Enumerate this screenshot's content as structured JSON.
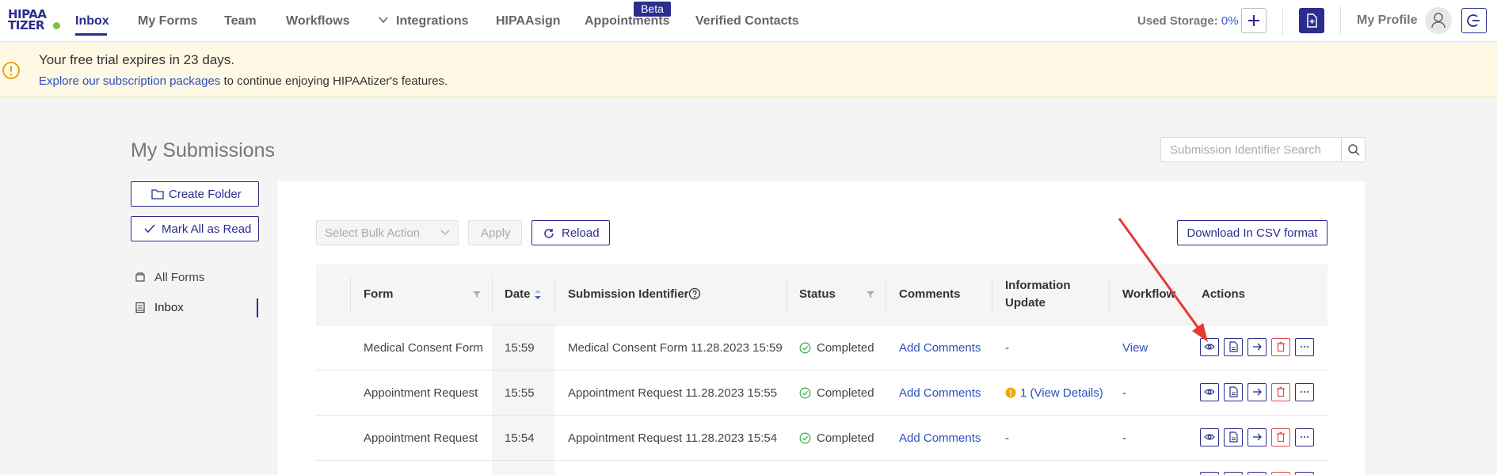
{
  "nav": {
    "logo_line1": "HIPAA",
    "logo_line2": "TIZER",
    "items": [
      "Inbox",
      "My Forms",
      "Team",
      "Workflows",
      "Integrations",
      "HIPAAsign",
      "Appointments",
      "Verified Contacts"
    ],
    "beta_badge": "Beta",
    "storage_label": "Used Storage:",
    "storage_value": "0%",
    "profile_label": "My Profile",
    "brand_color": "#2b2d8e"
  },
  "banner": {
    "title": "Your free trial expires in 23 days.",
    "link_text": "Explore our subscription packages",
    "suffix": " to continue enjoying HIPAAtizer's features."
  },
  "page": {
    "title": "My Submissions",
    "search_placeholder": "Submission Identifier Search"
  },
  "sidebar": {
    "create_folder": "Create Folder",
    "mark_all_read": "Mark All as Read",
    "items": [
      {
        "label": "All Forms",
        "icon": "box-icon"
      },
      {
        "label": "Inbox",
        "icon": "inbox-icon"
      }
    ]
  },
  "toolbar": {
    "bulk_placeholder": "Select Bulk Action",
    "apply": "Apply",
    "reload": "Reload",
    "csv": "Download In CSV format"
  },
  "table": {
    "columns": [
      "Form",
      "Date",
      "Submission Identifier",
      "Status",
      "Comments",
      "Information",
      "Update",
      "Workflow",
      "Actions"
    ],
    "rows": [
      {
        "form": "Medical Consent Form",
        "date": "15:59",
        "identifier": "Medical Consent Form 11.28.2023 15:59",
        "status": "Completed",
        "comments": "Add Comments",
        "info": "-",
        "info_link": "",
        "workflow": "View"
      },
      {
        "form": "Appointment Request",
        "date": "15:55",
        "identifier": "Appointment Request 11.28.2023 15:55",
        "status": "Completed",
        "comments": "Add Comments",
        "info": "",
        "info_link": "1 (View Details)",
        "workflow": "-"
      },
      {
        "form": "Appointment Request",
        "date": "15:54",
        "identifier": "Appointment Request 11.28.2023 15:54",
        "status": "Completed",
        "comments": "Add Comments",
        "info": "-",
        "info_link": "",
        "workflow": "-"
      }
    ]
  }
}
